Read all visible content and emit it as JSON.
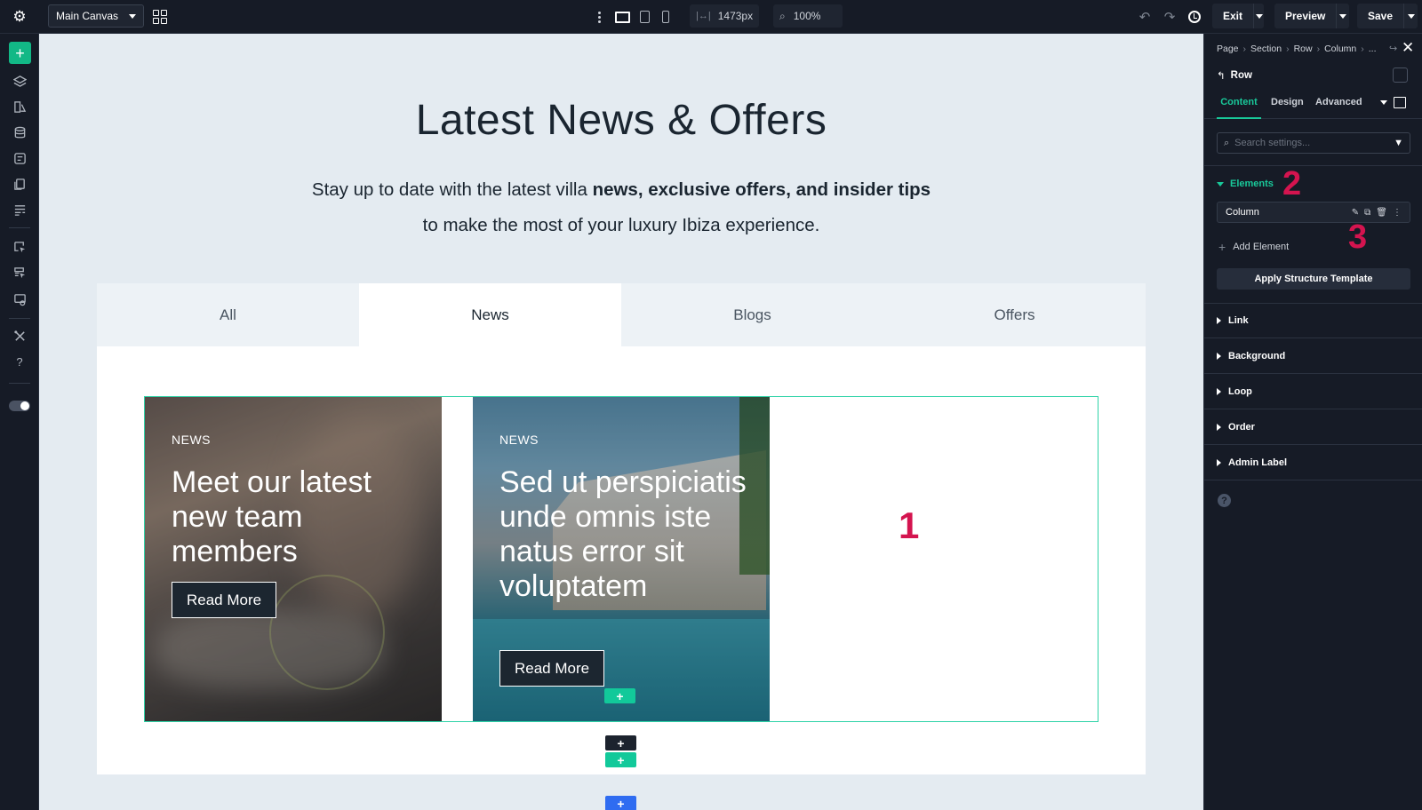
{
  "toolbar": {
    "canvas_select": "Main Canvas",
    "width_value": "1473px",
    "zoom_value": "100%",
    "exit_label": "Exit",
    "preview_label": "Preview",
    "save_label": "Save"
  },
  "canvas": {
    "headline": "Latest News & Offers",
    "subline_pre": "Stay up to date with the latest villa ",
    "subline_bold1": "news, exclusive offers, and insider tips",
    "subline_post": " to make the most of your luxury Ibiza experience.",
    "tabs": [
      "All",
      "News",
      "Blogs",
      "Offers"
    ],
    "active_tab": "News",
    "cards": [
      {
        "tag": "NEWS",
        "title": "Meet our latest new team members",
        "button": "Read More"
      },
      {
        "tag": "NEWS",
        "title": "Sed ut perspiciatis unde omnis iste natus error sit voluptatem",
        "button": "Read More"
      }
    ],
    "annotation_1": "1"
  },
  "panel": {
    "breadcrumb": [
      "Page",
      "Section",
      "Row",
      "Column",
      "..."
    ],
    "element_title": "Row",
    "tabs": [
      "Content",
      "Design",
      "Advanced"
    ],
    "active_tab": "Content",
    "search_placeholder": "Search settings...",
    "elements_heading": "Elements",
    "annotation_2": "2",
    "annotation_3": "3",
    "column_item": "Column",
    "add_element": "Add Element",
    "apply_template": "Apply Structure Template",
    "sections": [
      "Link",
      "Background",
      "Loop",
      "Order",
      "Admin Label"
    ]
  },
  "colors": {
    "accent": "#19c99a",
    "annotation": "#d4144f",
    "dark_bg": "#161b26",
    "canvas_bg": "#e4ebf1"
  }
}
